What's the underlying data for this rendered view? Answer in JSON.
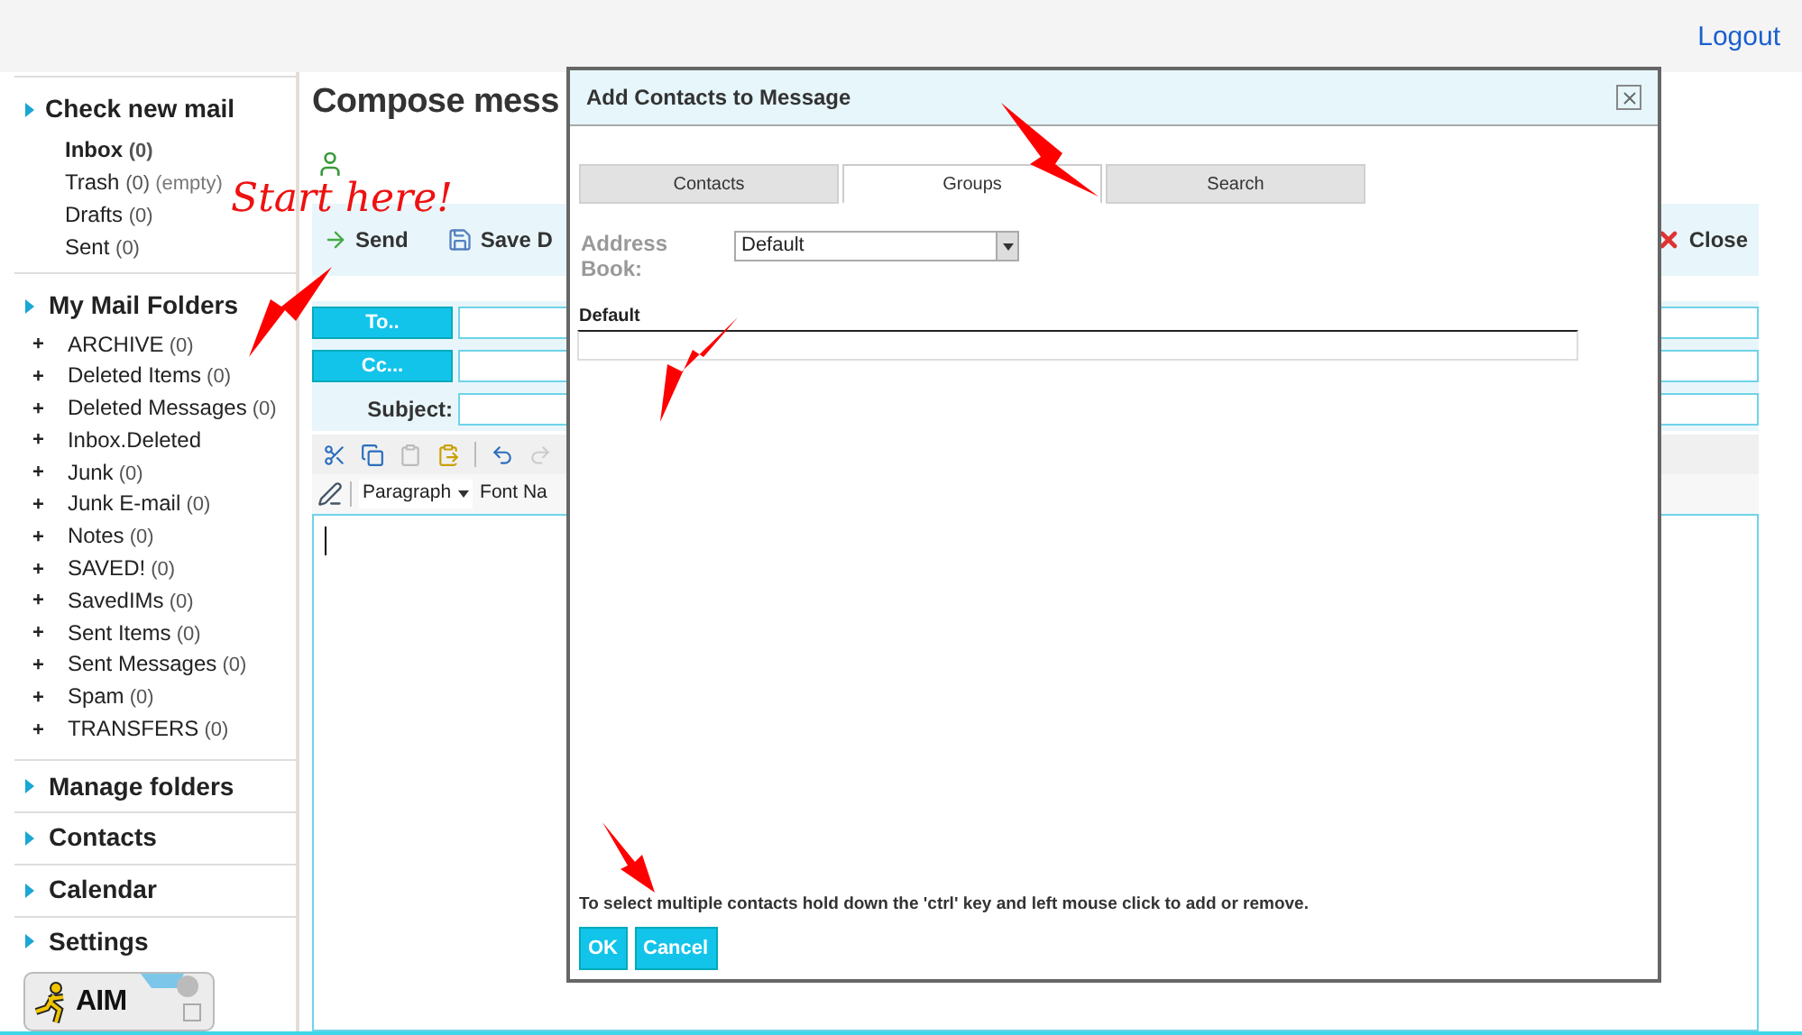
{
  "header": {
    "logout": "Logout"
  },
  "sidebar": {
    "check_mail": "Check new mail",
    "mailboxes": [
      {
        "name": "Inbox",
        "count": "(0)",
        "selected": true
      },
      {
        "name": "Trash",
        "count": "(0)",
        "extra": "(empty)",
        "selected": false
      },
      {
        "name": "Drafts",
        "count": "(0)",
        "selected": false
      },
      {
        "name": "Sent",
        "count": "(0)",
        "selected": false
      }
    ],
    "folders_title": "My Mail Folders",
    "folders": [
      {
        "expander": "+",
        "name": "ARCHIVE",
        "count": "(0)"
      },
      {
        "expander": "+",
        "name": "Deleted Items",
        "count": "(0)"
      },
      {
        "expander": "+",
        "name": "Deleted Messages",
        "count": "(0)"
      },
      {
        "expander": "+",
        "name": "Inbox.Deleted"
      },
      {
        "expander": "+",
        "name": "Junk",
        "count": "(0)"
      },
      {
        "expander": "+",
        "name": "Junk E-mail",
        "count": "(0)"
      },
      {
        "expander": "+",
        "name": "Notes",
        "count": "(0)"
      },
      {
        "expander": "+",
        "name": "SAVED!",
        "count": "(0)"
      },
      {
        "expander": "+",
        "name": "SavedIMs",
        "count": "(0)"
      },
      {
        "expander": "+",
        "name": "Sent Items",
        "count": "(0)"
      },
      {
        "expander": "+",
        "name": "Sent Messages",
        "count": "(0)"
      },
      {
        "expander": "+",
        "name": "Spam",
        "count": "(0)"
      },
      {
        "expander": "+",
        "name": "TRANSFERS",
        "count": "(0)"
      }
    ],
    "sections": [
      "Manage folders",
      "Contacts",
      "Calendar",
      "Settings"
    ],
    "aim": "AIM"
  },
  "compose": {
    "title": "Compose mess",
    "send": "Send",
    "save": "Save D",
    "close": "Close",
    "to": "To..",
    "cc": "Cc...",
    "subject": "Subject:",
    "format": "Paragraph",
    "font": "Font Na"
  },
  "dialog": {
    "title": "Add Contacts to Message",
    "tabs": [
      {
        "label": "Contacts",
        "selected": false
      },
      {
        "label": "Groups",
        "selected": true
      },
      {
        "label": "Search",
        "selected": false
      }
    ],
    "address_book_label": "Address Book:",
    "address_book": "Default",
    "list_label": "Default",
    "hint": "To select multiple contacts hold down the 'ctrl' key and left mouse click to add or remove.",
    "buttons": [
      "OK",
      "Cancel"
    ]
  },
  "annotation": {
    "text": "Start here!"
  }
}
